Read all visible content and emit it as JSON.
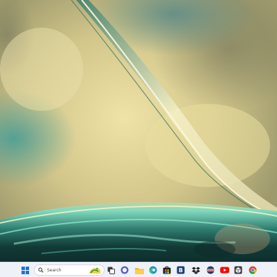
{
  "desktop": {
    "wallpaper_colors": {
      "sky_light": "#e6d9a0",
      "sky_mid": "#b9b27b",
      "teal_left": "#5aa59a",
      "teal_top": "#5e8d87",
      "wave_dark": "#173d3a",
      "wave_bright": "#7fe3c3",
      "streak_light": "#f7f1c9"
    }
  },
  "taskbar": {
    "background": "#eef1f7",
    "start": {
      "icon": "windows-logo-icon",
      "color": "#1a73d9"
    },
    "search": {
      "placeholder": "Search",
      "icon": "search-icon"
    },
    "pinned": [
      {
        "name": "task-view",
        "icon": "task-view-icon"
      },
      {
        "name": "chat",
        "icon": "chat-icon"
      },
      {
        "name": "file-explorer",
        "icon": "folder-icon"
      },
      {
        "name": "edge",
        "icon": "edge-icon"
      },
      {
        "name": "store",
        "icon": "store-icon"
      },
      {
        "name": "bitwarden",
        "icon": "shield-b-icon"
      },
      {
        "name": "dropbox",
        "icon": "dropbox-icon"
      },
      {
        "name": "app-orb",
        "icon": "orb-icon"
      },
      {
        "name": "youtube",
        "icon": "youtube-icon"
      },
      {
        "name": "package",
        "icon": "box-icon"
      },
      {
        "name": "chrome",
        "icon": "chrome-icon"
      }
    ]
  }
}
